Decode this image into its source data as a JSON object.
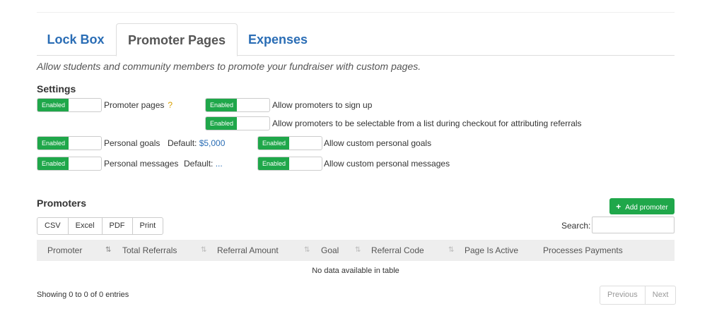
{
  "tabs": [
    {
      "label": "Lock Box"
    },
    {
      "label": "Promoter Pages"
    },
    {
      "label": "Expenses"
    }
  ],
  "intro": "Allow students and community members to promote your fundraiser with custom pages.",
  "settings": {
    "title": "Settings",
    "toggle_on_label": "Enabled",
    "promoter_pages": "Promoter pages",
    "help_mark": "?",
    "allow_signup": "Allow promoters to sign up",
    "allow_selectable": "Allow promoters to be selectable from a list during checkout for attributing referrals",
    "personal_goals": "Personal goals",
    "goal_default_label": "Default:",
    "goal_default_value": "$5,000",
    "allow_custom_goals": "Allow custom personal goals",
    "personal_messages": "Personal messages",
    "message_default_label": "Default:",
    "message_default_value": "...",
    "allow_custom_messages": "Allow custom personal messages"
  },
  "promoters": {
    "title": "Promoters",
    "add_button": "Add promoter",
    "export_buttons": [
      "CSV",
      "Excel",
      "PDF",
      "Print"
    ],
    "search_label": "Search:",
    "search_value": "",
    "columns": [
      "Promoter",
      "Total Referrals",
      "Referral Amount",
      "Goal",
      "Referral Code",
      "Page Is Active",
      "Processes Payments"
    ],
    "empty_message": "No data available in table",
    "info": "Showing 0 to 0 of 0 entries",
    "pager": {
      "previous": "Previous",
      "next": "Next"
    }
  },
  "colors": {
    "accent": "#2a6db5",
    "enabled_green": "#1fa74a",
    "help_mark": "#d9a000",
    "header_bg": "#eeeeee"
  },
  "icons": {
    "sort": "sort-icon",
    "plus": "plus-icon",
    "help": "question-mark-icon"
  }
}
